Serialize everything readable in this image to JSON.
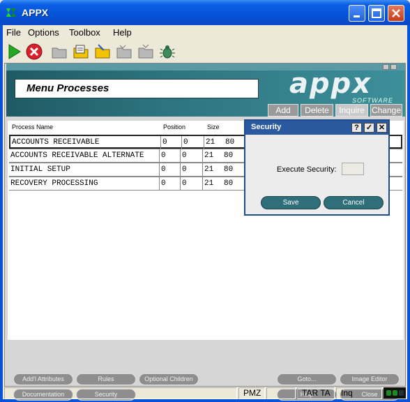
{
  "window": {
    "title": "APPX"
  },
  "menubar": {
    "items": [
      "File",
      "Options",
      "Toolbox",
      "Help"
    ]
  },
  "toolbar": {
    "icons": [
      "run-icon",
      "stop-icon",
      "folder-icon",
      "notepad-icon",
      "edit-folder-icon",
      "folder-icon",
      "folder-icon",
      "bug-icon"
    ]
  },
  "header": {
    "title": "Menu Processes",
    "logo": "appx",
    "logo_sub": "SOFTWARE",
    "modes": [
      "Add",
      "Delete",
      "Inquire",
      "Change"
    ],
    "active_mode": "Inquire"
  },
  "table": {
    "columns": [
      "Process Name",
      "Position",
      "Size"
    ],
    "rows": [
      {
        "name": "ACCOUNTS RECEIVABLE",
        "pos_row": "0",
        "pos_col": "0",
        "size_rows": "21",
        "size_cols": "80"
      },
      {
        "name": "ACCOUNTS RECEIVABLE ALTERNATE",
        "pos_row": "0",
        "pos_col": "0",
        "size_rows": "21",
        "size_cols": "80"
      },
      {
        "name": "INITIAL SETUP",
        "pos_row": "0",
        "pos_col": "0",
        "size_rows": "21",
        "size_cols": "80"
      },
      {
        "name": "RECOVERY PROCESSING",
        "pos_row": "0",
        "pos_col": "0",
        "size_rows": "21",
        "size_cols": "80"
      }
    ]
  },
  "bottom_buttons": {
    "addl_attributes": "Add'l Attributes",
    "rules": "Rules",
    "optional_children": "Optional Children",
    "goto": "Goto...",
    "image_editor": "Image Editor",
    "documentation": "Documentation",
    "security": "Security",
    "help": "Help",
    "close": "Close"
  },
  "statusbar": {
    "cells": [
      "",
      "PMZ",
      "",
      "TAR TA",
      "Inq"
    ]
  },
  "dialog": {
    "title": "Security",
    "help_btn": "?",
    "ok_btn": "✓",
    "close_btn": "✕",
    "label": "Execute Security:",
    "value": "",
    "save": "Save",
    "cancel": "Cancel"
  },
  "colors": {
    "title_bar": "#0453d6",
    "header_band": "#2d7480",
    "dialog_title": "#2a59a0",
    "dialog_button": "#2e6f7a"
  }
}
